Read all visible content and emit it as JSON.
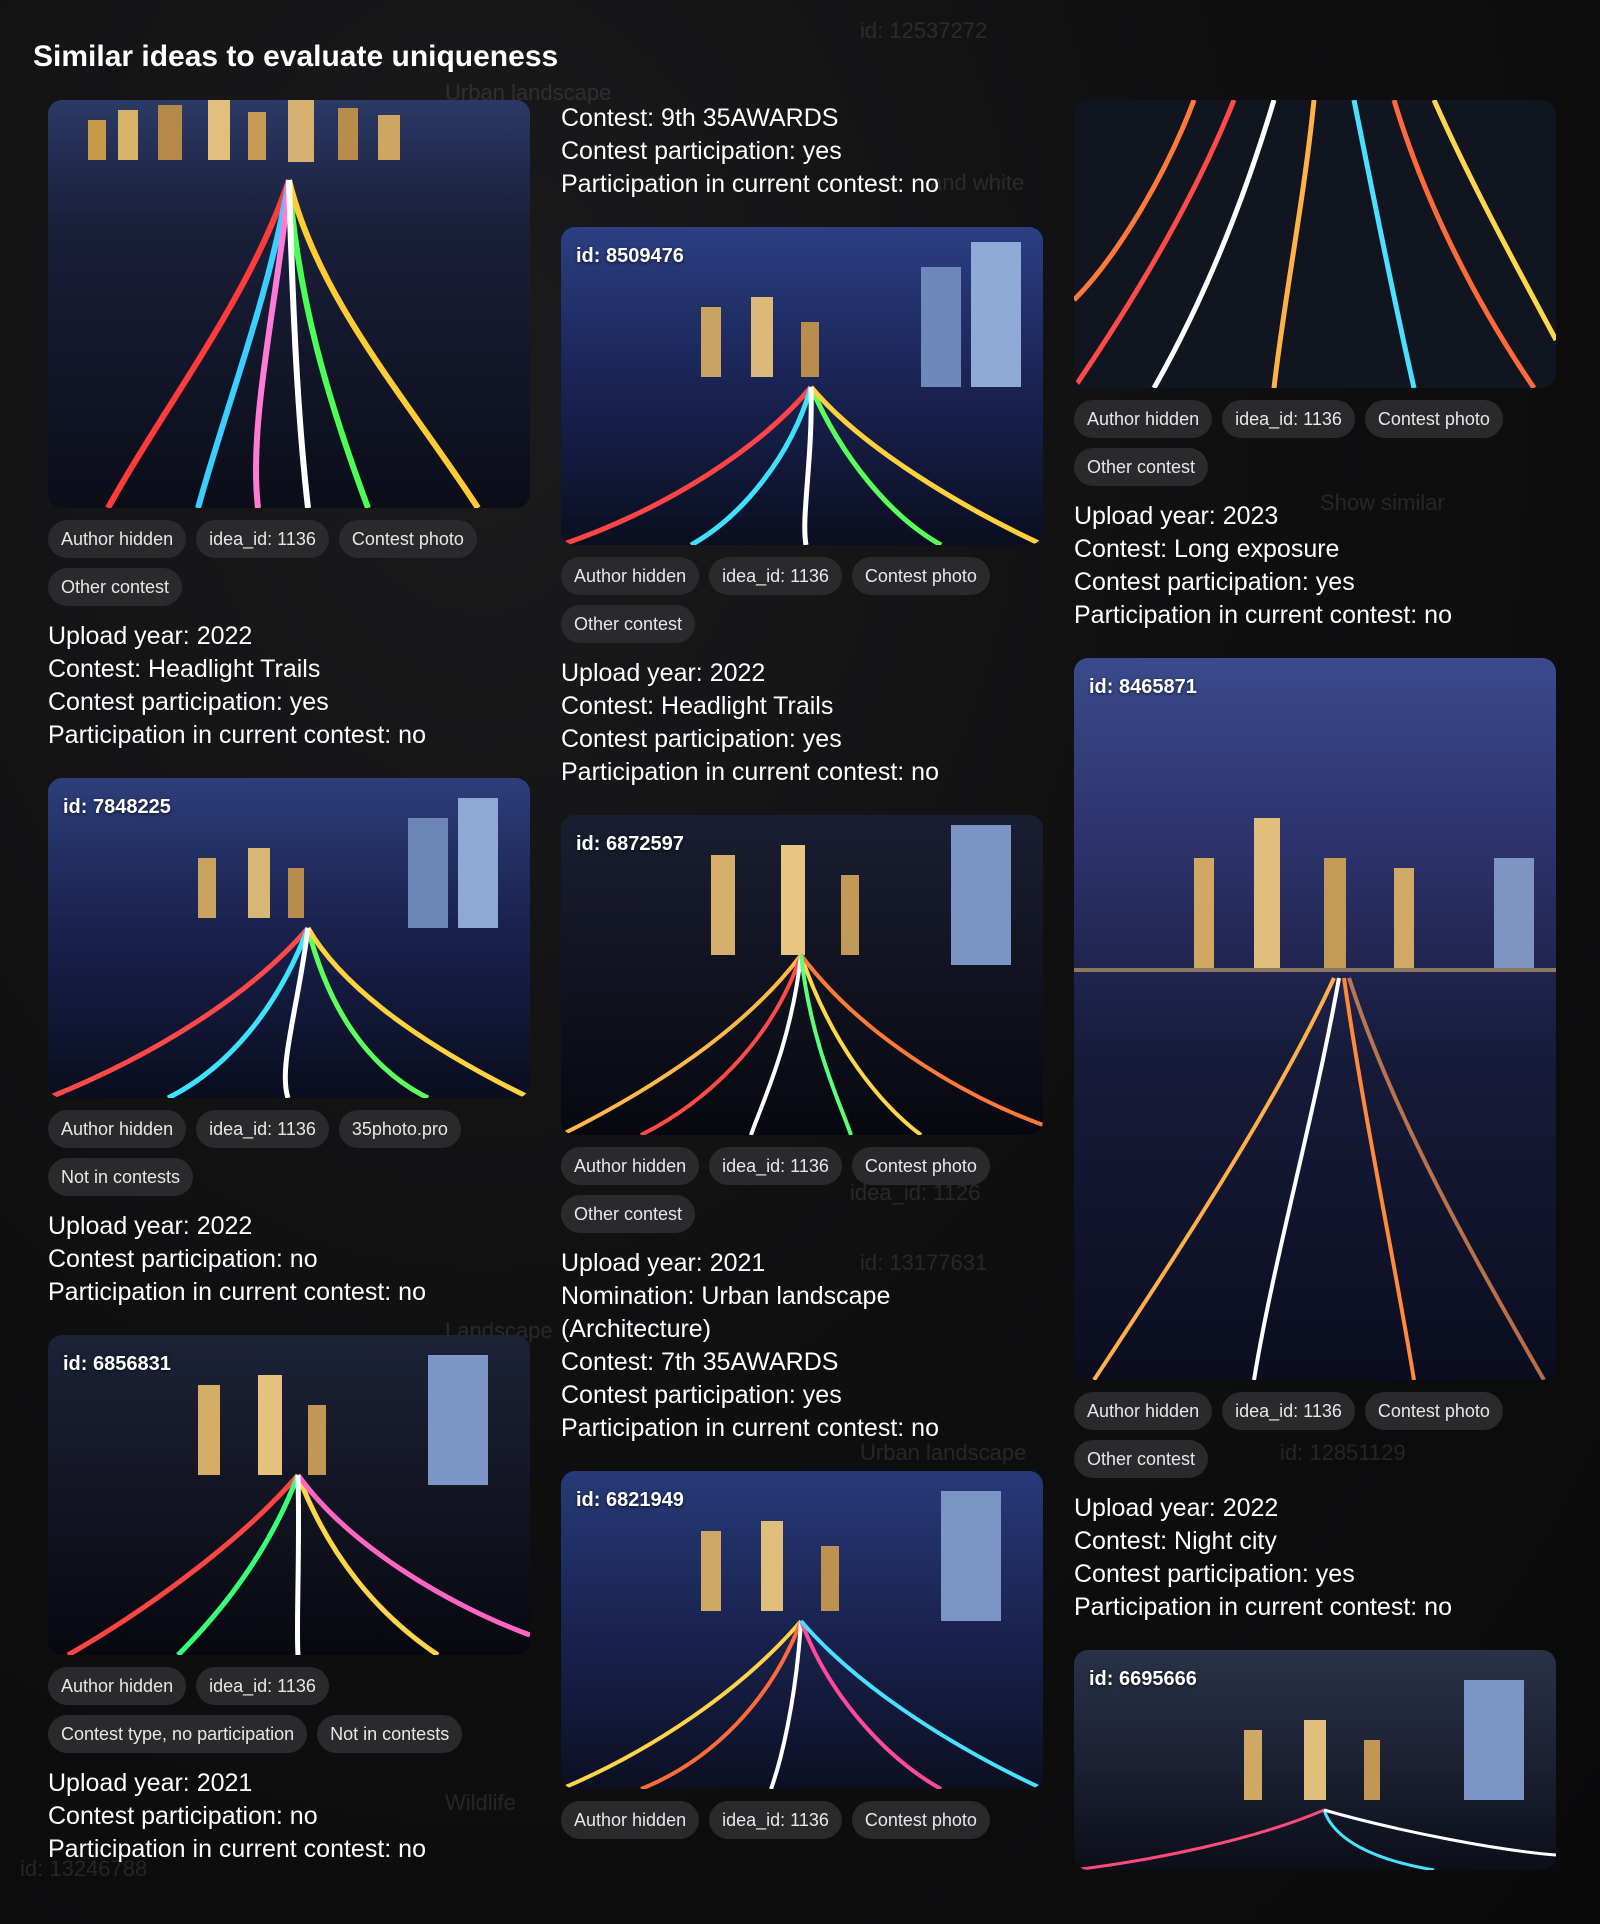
{
  "title": "Similar ideas to evaluate uniqueness",
  "background_text": [
    "id: 12537272",
    "Urban landscape",
    "and white",
    "Show similar",
    "idea_id: 1126",
    "id: 13177631",
    "Urban landscape",
    "id: 12851129",
    "Wildlife",
    "id: 13246788",
    "Landscape"
  ],
  "columns": [
    [
      {
        "id_label": "",
        "tags": [
          "Author hidden",
          "idea_id: 1136",
          "Contest photo",
          "Other contest"
        ],
        "meta": [
          "Upload year: 2022",
          "Contest: Headlight Trails",
          "Contest participation: yes",
          "Participation in current contest: no"
        ]
      },
      {
        "id_label": "id: 7848225",
        "tags": [
          "Author hidden",
          "idea_id: 1136",
          "35photo.pro",
          "Not in contests"
        ],
        "meta": [
          "Upload year: 2022",
          "Contest participation: no",
          "Participation in current contest: no"
        ]
      },
      {
        "id_label": "id: 6856831",
        "tags": [
          "Author hidden",
          "idea_id: 1136",
          "Contest type, no participation",
          "Not in contests"
        ],
        "meta": [
          "Upload year: 2021",
          "Contest participation: no",
          "Participation in current contest: no"
        ]
      }
    ],
    [
      {
        "id_label": "",
        "tags": [],
        "meta": [
          "Contest: 9th 35AWARDS",
          "Contest participation: yes",
          "Participation in current contest: no"
        ]
      },
      {
        "id_label": "id: 8509476",
        "tags": [
          "Author hidden",
          "idea_id: 1136",
          "Contest photo",
          "Other contest"
        ],
        "meta": [
          "Upload year: 2022",
          "Contest: Headlight Trails",
          "Contest participation: yes",
          "Participation in current contest: no"
        ]
      },
      {
        "id_label": "id: 6872597",
        "tags": [
          "Author hidden",
          "idea_id: 1136",
          "Contest photo",
          "Other contest"
        ],
        "meta": [
          "Upload year: 2021",
          "Nomination: Urban landscape (Architecture)",
          "Contest: 7th 35AWARDS",
          "Contest participation: yes",
          "Participation in current contest: no"
        ]
      },
      {
        "id_label": "id: 6821949",
        "tags": [
          "Author hidden",
          "idea_id: 1136",
          "Contest photo"
        ],
        "meta": []
      }
    ],
    [
      {
        "id_label": "",
        "tags": [
          "Author hidden",
          "idea_id: 1136",
          "Contest photo",
          "Other contest"
        ],
        "meta": [
          "Upload year: 2023",
          "Contest: Long exposure",
          "Contest participation: yes",
          "Participation in current contest: no"
        ]
      },
      {
        "id_label": "id: 8465871",
        "tags": [
          "Author hidden",
          "idea_id: 1136",
          "Contest photo",
          "Other contest"
        ],
        "meta": [
          "Upload year: 2022",
          "Contest: Night city",
          "Contest participation: yes",
          "Participation in current contest: no"
        ]
      },
      {
        "id_label": "id: 6695666",
        "tags": [],
        "meta": []
      }
    ]
  ],
  "colors": {
    "bg": "#0c0c0d",
    "tag_bg": "#2a2a2c",
    "text": "#ffffff"
  }
}
